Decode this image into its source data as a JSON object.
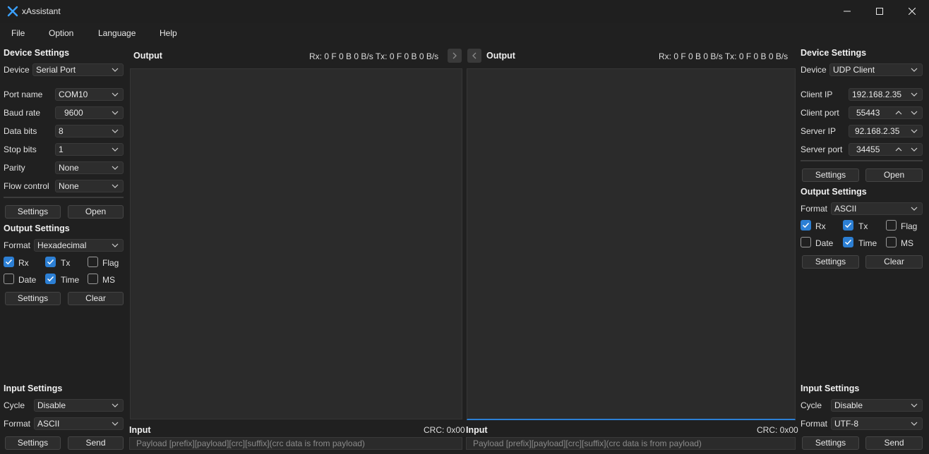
{
  "window": {
    "title": "xAssistant"
  },
  "menu": [
    "File",
    "Option",
    "Language",
    "Help"
  ],
  "left": {
    "device_settings": {
      "title": "Device Settings",
      "device_label": "Device",
      "device_value": "Serial Port",
      "fields": [
        {
          "label": "Port name",
          "value": "COM10"
        },
        {
          "label": "Baud rate",
          "value": "9600"
        },
        {
          "label": "Data bits",
          "value": "8"
        },
        {
          "label": "Stop bits",
          "value": "1"
        },
        {
          "label": "Parity",
          "value": "None"
        },
        {
          "label": "Flow control",
          "value": "None"
        }
      ],
      "settings_btn": "Settings",
      "open_btn": "Open"
    },
    "output_settings": {
      "title": "Output Settings",
      "format_label": "Format",
      "format_value": "Hexadecimal",
      "checks": [
        {
          "label": "Rx",
          "checked": true
        },
        {
          "label": "Tx",
          "checked": true
        },
        {
          "label": "Flag",
          "checked": false
        },
        {
          "label": "Date",
          "checked": false
        },
        {
          "label": "Time",
          "checked": true
        },
        {
          "label": "MS",
          "checked": false
        }
      ],
      "settings_btn": "Settings",
      "clear_btn": "Clear"
    },
    "input_settings": {
      "title": "Input Settings",
      "cycle_label": "Cycle",
      "cycle_value": "Disable",
      "format_label": "Format",
      "format_value": "ASCII",
      "settings_btn": "Settings",
      "send_btn": "Send"
    }
  },
  "center_left": {
    "output_title": "Output",
    "stats": "Rx: 0 F 0 B 0 B/s Tx: 0 F 0 B 0 B/s",
    "input_title": "Input",
    "crc": "CRC: 0x00",
    "input_placeholder": "Payload [prefix][payload][crc][suffix](crc data is from payload)"
  },
  "center_right": {
    "output_title": "Output",
    "stats": "Rx: 0 F 0 B 0 B/s Tx: 0 F 0 B 0 B/s",
    "input_title": "Input",
    "crc": "CRC: 0x00",
    "input_placeholder": "Payload [prefix][payload][crc][suffix](crc data is from payload)"
  },
  "right": {
    "device_settings": {
      "title": "Device Settings",
      "device_label": "Device",
      "device_value": "UDP Client",
      "fields": [
        {
          "label": "Client IP",
          "value": "192.168.2.35"
        },
        {
          "label": "Client port",
          "value": "55443"
        },
        {
          "label": "Server IP",
          "value": "92.168.2.35"
        },
        {
          "label": "Server port",
          "value": "34455"
        }
      ],
      "settings_btn": "Settings",
      "open_btn": "Open"
    },
    "output_settings": {
      "title": "Output Settings",
      "format_label": "Format",
      "format_value": "ASCII",
      "checks": [
        {
          "label": "Rx",
          "checked": true
        },
        {
          "label": "Tx",
          "checked": true
        },
        {
          "label": "Flag",
          "checked": false
        },
        {
          "label": "Date",
          "checked": false
        },
        {
          "label": "Time",
          "checked": true
        },
        {
          "label": "MS",
          "checked": false
        }
      ],
      "settings_btn": "Settings",
      "clear_btn": "Clear"
    },
    "input_settings": {
      "title": "Input Settings",
      "cycle_label": "Cycle",
      "cycle_value": "Disable",
      "format_label": "Format",
      "format_value": "UTF-8",
      "settings_btn": "Settings",
      "send_btn": "Send"
    }
  },
  "colors": {
    "accent": "#2c7fd4",
    "background": "#202020",
    "panel": "#2b2b2b"
  }
}
